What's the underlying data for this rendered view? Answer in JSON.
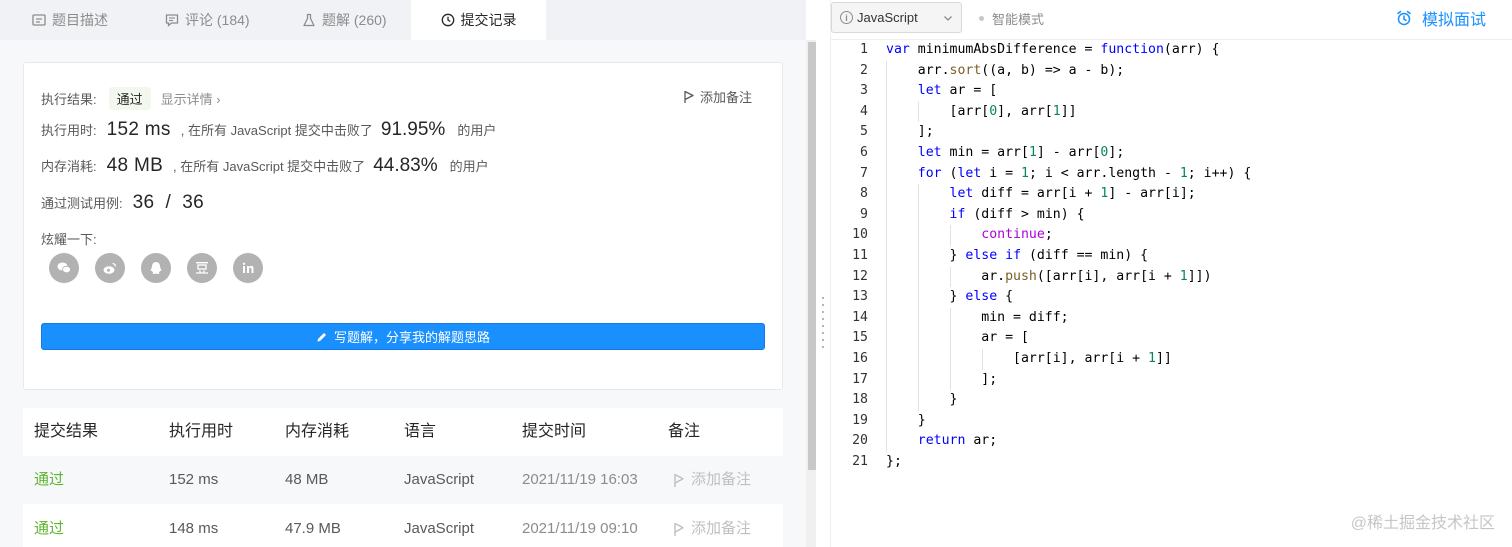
{
  "tabs": [
    {
      "label": "题目描述",
      "icon": "description-icon"
    },
    {
      "label": "评论 (184)",
      "icon": "comment-icon"
    },
    {
      "label": "题解 (260)",
      "icon": "flask-icon"
    },
    {
      "label": "提交记录",
      "icon": "clock-icon"
    }
  ],
  "result": {
    "label": "执行结果:",
    "status": "通过",
    "details_link": "显示详情 ›",
    "add_note": "添加备注",
    "runtime_label": "执行用时:",
    "runtime_value": "152 ms",
    "runtime_text": ", 在所有 JavaScript 提交中击败了",
    "runtime_pct": "91.95%",
    "runtime_suffix": "的用户",
    "memory_label": "内存消耗:",
    "memory_value": "48 MB",
    "memory_text": ", 在所有 JavaScript 提交中击败了",
    "memory_pct": "44.83%",
    "memory_suffix": "的用户",
    "tests_label": "通过测试用例:",
    "tests_value": "36  /  36",
    "share_label": "炫耀一下:",
    "share_icons": [
      "wechat-icon",
      "weibo-icon",
      "qq-icon",
      "douban-icon",
      "linkedin-icon"
    ],
    "write_solution": "写题解，分享我的解题思路"
  },
  "table": {
    "headers": [
      "提交结果",
      "执行用时",
      "内存消耗",
      "语言",
      "提交时间",
      "备注"
    ],
    "rows": [
      {
        "result": "通过",
        "runtime": "152 ms",
        "memory": "48 MB",
        "lang": "JavaScript",
        "time": "2021/11/19 16:03",
        "note": "添加备注"
      },
      {
        "result": "通过",
        "runtime": "148 ms",
        "memory": "47.9 MB",
        "lang": "JavaScript",
        "time": "2021/11/19 09:10",
        "note": "添加备注"
      }
    ]
  },
  "editor": {
    "language": "JavaScript",
    "smart_mode": "智能模式",
    "mock_interview": "模拟面试",
    "line_numbers": [
      "1",
      "2",
      "3",
      "4",
      "5",
      "6",
      "7",
      "8",
      "9",
      "10",
      "11",
      "12",
      "13",
      "14",
      "15",
      "16",
      "17",
      "18",
      "19",
      "20",
      "21"
    ],
    "code_lines": [
      "var minimumAbsDifference = function(arr) {",
      "    arr.sort((a, b) => a - b);",
      "    let ar = [",
      "        [arr[0], arr[1]]",
      "    ];",
      "    let min = arr[1] - arr[0];",
      "    for (let i = 1; i < arr.length - 1; i++) {",
      "        let diff = arr[i + 1] - arr[i];",
      "        if (diff > min) {",
      "            continue;",
      "        } else if (diff == min) {",
      "            ar.push([arr[i], arr[i + 1]])",
      "        } else {",
      "            min = diff;",
      "            ar = [",
      "                [arr[i], arr[i + 1]]",
      "            ];",
      "        }",
      "    }",
      "    return ar;",
      "};"
    ]
  },
  "watermark": "@稀土掘金技术社区",
  "colors": {
    "accent": "#1a90ff",
    "pass": "#5fb432"
  }
}
